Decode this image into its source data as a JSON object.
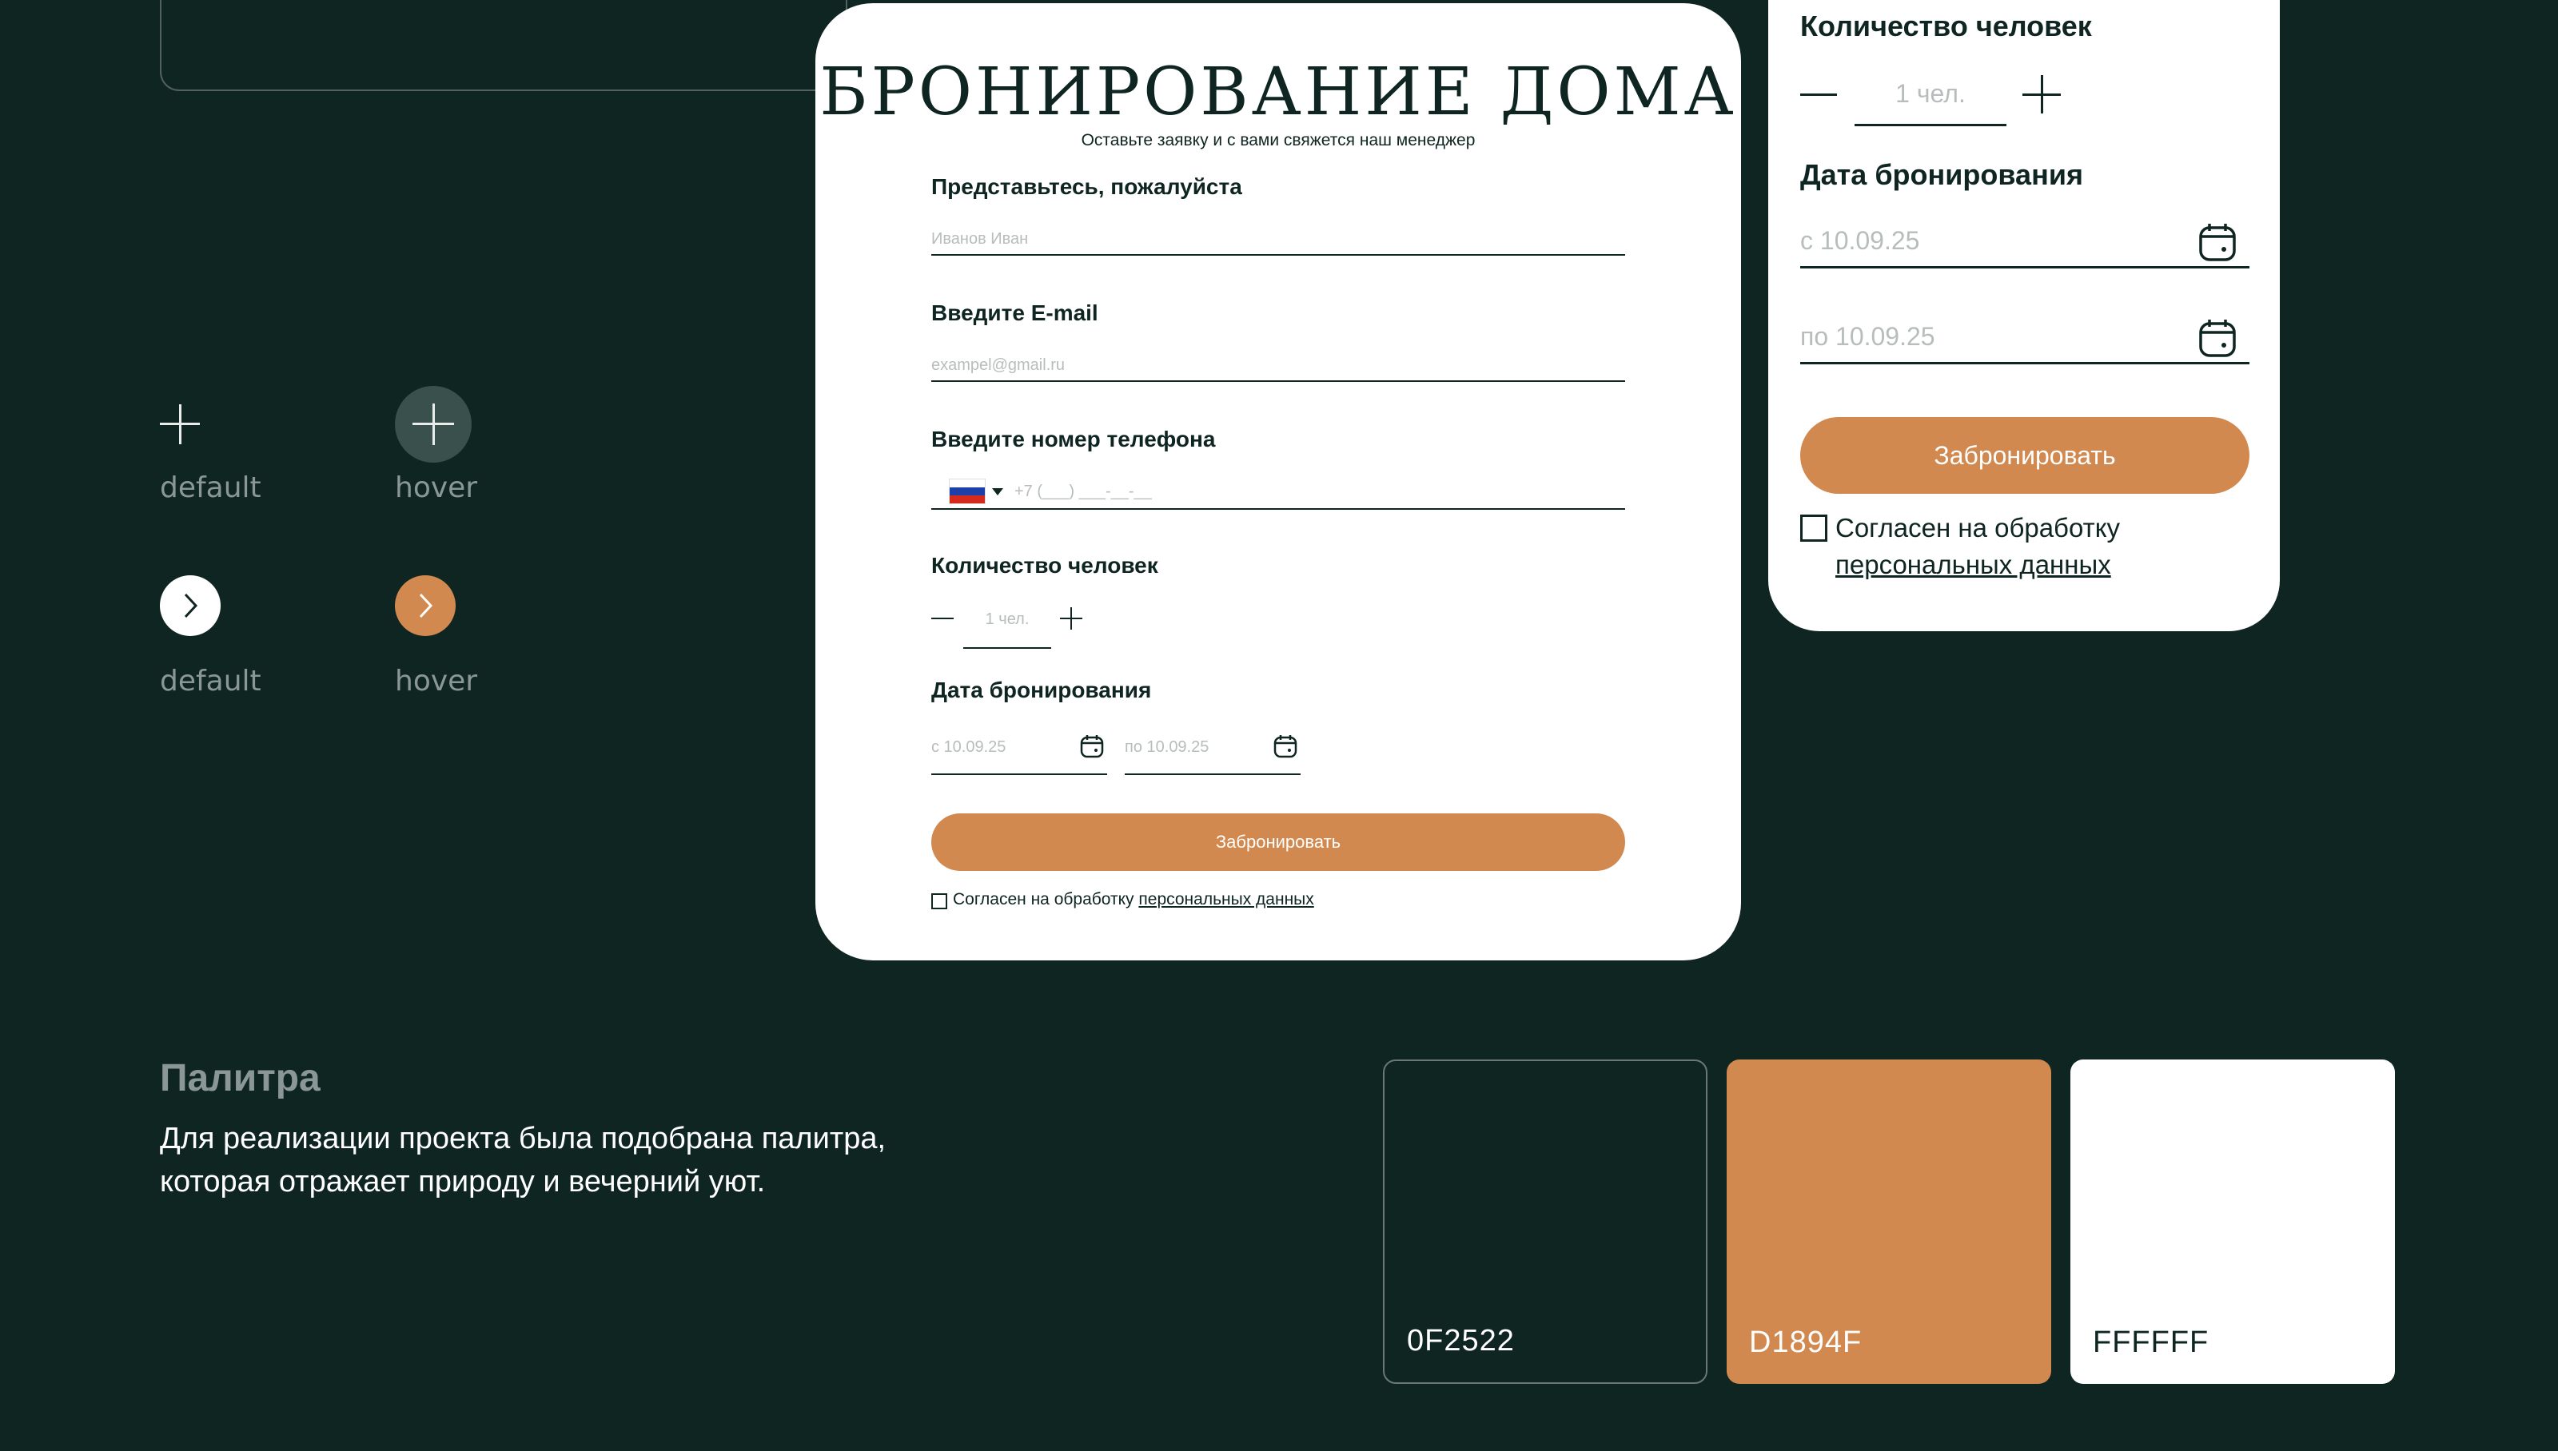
{
  "states": {
    "default_label": "default",
    "hover_label": "hover"
  },
  "modal": {
    "title": "БРОНИРОВАНИЕ ДОМА",
    "subtitle": "Оставьте заявку и с вами свяжется наш менеджер",
    "name_label": "Представьтесь, пожалуйста",
    "name_placeholder": "Иванов Иван",
    "email_label": "Введите E-mail",
    "email_placeholder": "exampel@gmail.ru",
    "phone_label": "Введите номер телефона",
    "phone_placeholder": "+7 (___) ___-__-__",
    "guests_label": "Количество человек",
    "guests_value": "1 чел.",
    "dates_label": "Дата бронирования",
    "date_from": "с 10.09.25",
    "date_to": "по 10.09.25",
    "book_button": "Забронировать",
    "consent_prefix": "Согласен на обработку",
    "consent_link": "персональных данных"
  },
  "panel": {
    "guests_label": "Количество человек",
    "guests_value": "1 чел.",
    "dates_label": "Дата бронирования",
    "date_from": "с 10.09.25",
    "date_to": "по 10.09.25",
    "book_button": "Забронировать",
    "consent_prefix": "Согласен на обработку",
    "consent_link": "персональных данных"
  },
  "palette": {
    "title": "Палитра",
    "description": "Для реализации проекта  была подобрана палитра, которая отражает природу и вечерний уют.",
    "colors": [
      {
        "code": "0F2522",
        "hex": "#0F2522"
      },
      {
        "code": "D1894F",
        "hex": "#D1894F"
      },
      {
        "code": "FFFFFF",
        "hex": "#FFFFFF"
      }
    ]
  }
}
